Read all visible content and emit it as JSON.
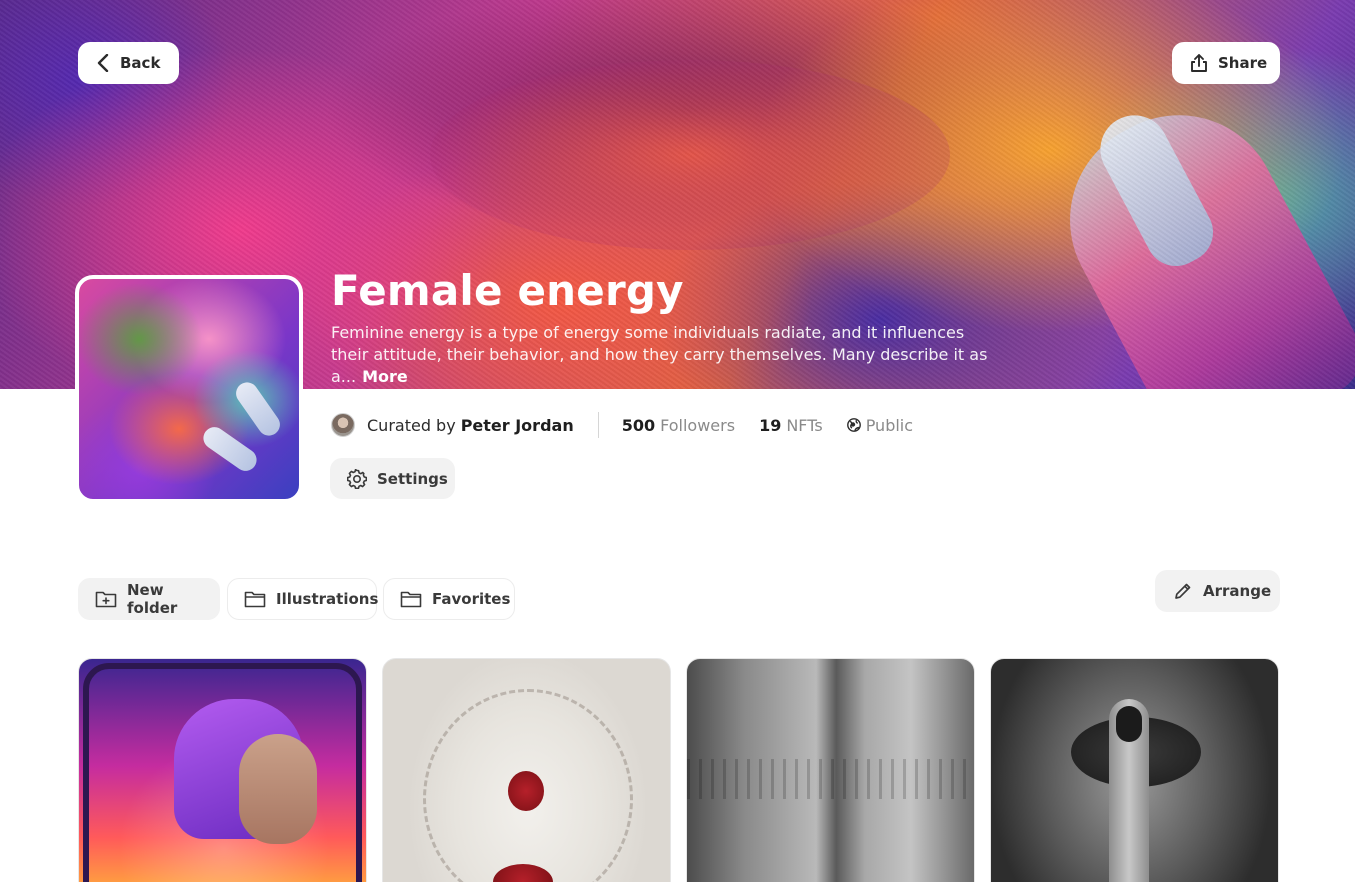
{
  "header": {
    "back_label": "Back",
    "share_label": "Share"
  },
  "collection": {
    "title": "Female energy",
    "description": "Feminine energy is a type of energy some individuals radiate, and it influences their attitude, their behavior, and how they carry themselves. Many describe it as a...",
    "more_label": "More",
    "curated_by_label": "Curated by",
    "curator_name": "Peter Jordan",
    "followers_count": "500",
    "followers_label": "Followers",
    "nfts_count": "19",
    "nfts_label": "NFTs",
    "visibility": "Public",
    "settings_label": "Settings"
  },
  "folders": {
    "new_folder_label": "New folder",
    "items": [
      {
        "label": "Illustrations"
      },
      {
        "label": "Favorites"
      }
    ],
    "arrange_label": "Arrange"
  },
  "icons": {
    "back": "chevron-left-icon",
    "share": "share-icon",
    "settings": "gear-icon",
    "new_folder": "folder-plus-icon",
    "folder": "folder-icon",
    "arrange": "pencil-icon",
    "visibility": "globe-icon"
  },
  "colors": {
    "page_background": "#ffffff",
    "button_background": "#f2f2f2",
    "muted_text": "#8a8a8a"
  }
}
